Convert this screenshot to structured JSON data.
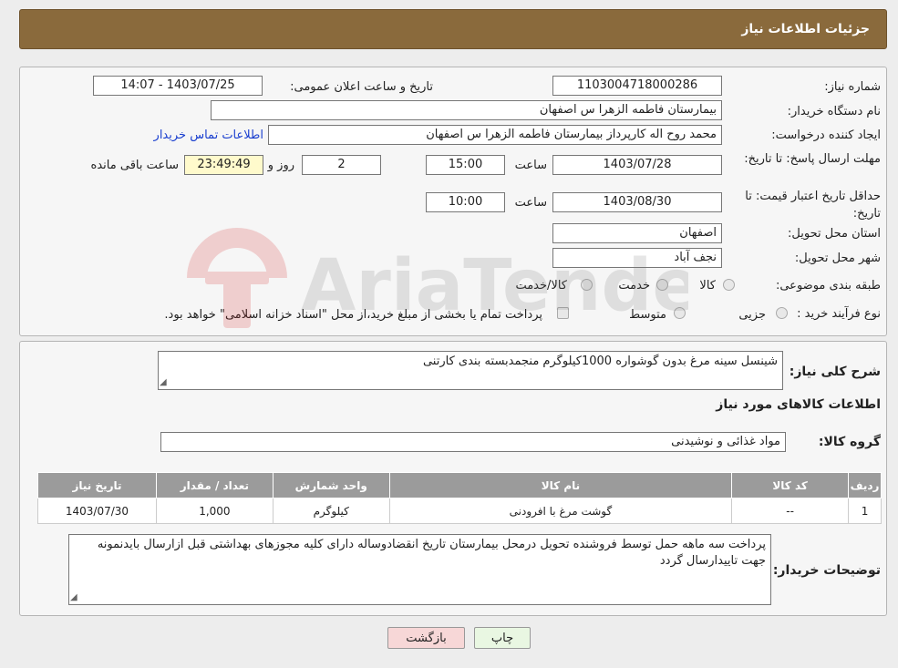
{
  "header": {
    "title": "جزئیات اطلاعات نیاز"
  },
  "form": {
    "need_number_label": "شماره نیاز:",
    "need_number": "1103004718000286",
    "announce_label": "تاریخ و ساعت اعلان عمومی:",
    "announce_value": "1403/07/25 - 14:07",
    "buyer_org_label": "نام دستگاه خریدار:",
    "buyer_org": "بیمارستان فاطمه الزهرا س  اصفهان",
    "creator_label": "ایجاد کننده درخواست:",
    "creator": "محمد روح اله کارپرداز بیمارستان فاطمه الزهرا س  اصفهان",
    "contact_link": "اطلاعات تماس خریدار",
    "reply_deadline_label": "مهلت ارسال پاسخ: تا تاریخ:",
    "reply_date": "1403/07/28",
    "time_label": "ساعت",
    "reply_time": "15:00",
    "days_value": "2",
    "days_label": "روز و",
    "remaining_time": "23:49:49",
    "remaining_label": "ساعت باقی مانده",
    "price_validity_label": "حداقل تاریخ اعتبار قیمت: تا تاریخ:",
    "validity_date": "1403/08/30",
    "validity_time": "10:00",
    "province_label": "استان محل تحویل:",
    "province": "اصفهان",
    "city_label": "شهر محل تحویل:",
    "city": "نجف آباد",
    "category_label": "طبقه بندی موضوعی:",
    "category_options": [
      "کالا",
      "خدمت",
      "کالا/خدمت"
    ],
    "process_label": "نوع فرآیند خرید :",
    "process_options": [
      "جزیی",
      "متوسط"
    ],
    "process_note": "پرداخت تمام یا بخشی از مبلغ خرید،از محل \"اسناد خزانه اسلامی\" خواهد بود."
  },
  "details": {
    "summary_label": "شرح کلی نیاز:",
    "summary": "شینسل سینه مرغ بدون گوشواره 1000کیلوگرم منجمدبسته بندی کارتنی",
    "goods_info_title": "اطلاعات کالاهای مورد نیاز",
    "goods_group_label": "گروه کالا:",
    "goods_group": "مواد غذائی و نوشیدنی",
    "table": {
      "headers": [
        "ردیف",
        "کد کالا",
        "نام کالا",
        "واحد شمارش",
        "تعداد / مقدار",
        "تاریخ نیاز"
      ],
      "rows": [
        [
          "1",
          "--",
          "گوشت مرغ با افرودنی",
          "کیلوگرم",
          "1,000",
          "1403/07/30"
        ]
      ]
    },
    "buyer_notes_label": "توضیحات خریدار:",
    "buyer_notes": "پرداخت سه ماهه حمل توسط فروشنده تحویل درمحل بیمارستان تاریخ انقضادوساله دارای کلیه مجوزهای بهداشتی قبل ازارسال بایدنمونه جهت تاییدارسال گردد"
  },
  "buttons": {
    "print": "چاپ",
    "back": "بازگشت"
  },
  "watermark": {
    "text": "AriaTender.neT"
  },
  "colors": {
    "header": "#8a6a3c",
    "link": "#1a3fcf",
    "back_button": "#f7d7d7",
    "print_button": "#e9f7e2"
  }
}
